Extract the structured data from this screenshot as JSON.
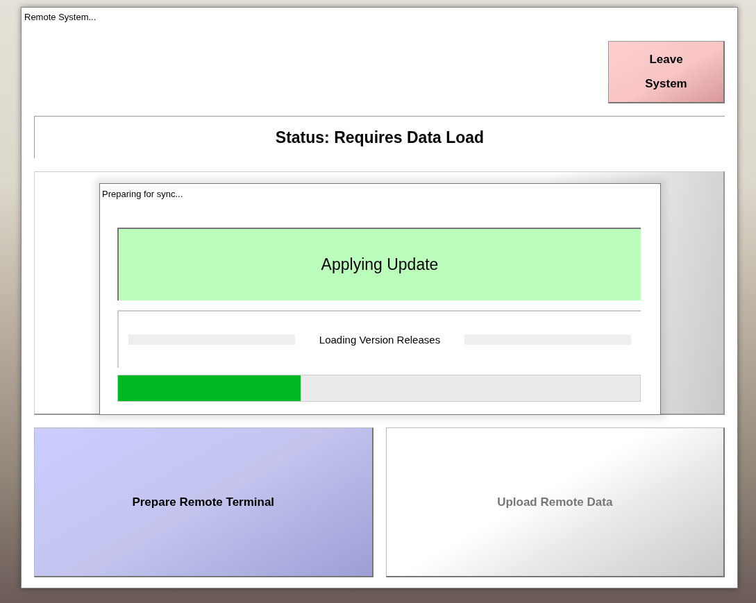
{
  "window": {
    "title": "Remote System..."
  },
  "leave_button": {
    "lines": [
      "Leave",
      "System"
    ]
  },
  "status": {
    "text": "Status: Requires Data Load"
  },
  "dialog": {
    "title": "Preparing for sync...",
    "banner": "Applying Update",
    "step": "Loading Version Releases",
    "progress": {
      "level": 0.35
    }
  },
  "actions": [
    {
      "label": "Prepare Remote Terminal",
      "disabled": false
    },
    {
      "label": "Upload Remote Data",
      "disabled": true
    }
  ]
}
